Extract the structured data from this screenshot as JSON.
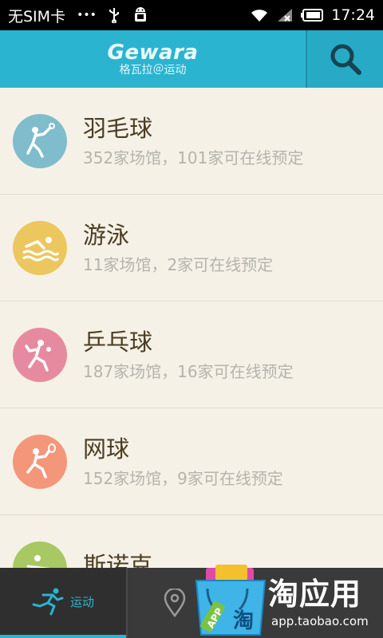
{
  "status": {
    "carrier": "无SIM卡",
    "dots": "•••",
    "time": "17:24"
  },
  "header": {
    "brand_title": "Gewara",
    "brand_sub": "格瓦拉＠运动"
  },
  "sports": [
    {
      "name": "羽毛球",
      "desc": "352家场馆，101家可在线预定",
      "color": "#7fbccc",
      "icon": "badminton-icon"
    },
    {
      "name": "游泳",
      "desc": "11家场馆，2家可在线预定",
      "color": "#ecc75f",
      "icon": "swimming-icon"
    },
    {
      "name": "乒乓球",
      "desc": "187家场馆，16家可在线预定",
      "color": "#e68aa0",
      "icon": "pingpong-icon"
    },
    {
      "name": "网球",
      "desc": "152家场馆，9家可在线预定",
      "color": "#f4967a",
      "icon": "tennis-icon"
    },
    {
      "name": "斯诺克",
      "desc": "",
      "color": "#a7c862",
      "icon": "snooker-icon"
    }
  ],
  "tabbar": {
    "sport_label": "运动"
  },
  "promo": {
    "title": "淘应用",
    "url": "app.taobao.com",
    "badge": "APP",
    "bag_char": "淘"
  }
}
